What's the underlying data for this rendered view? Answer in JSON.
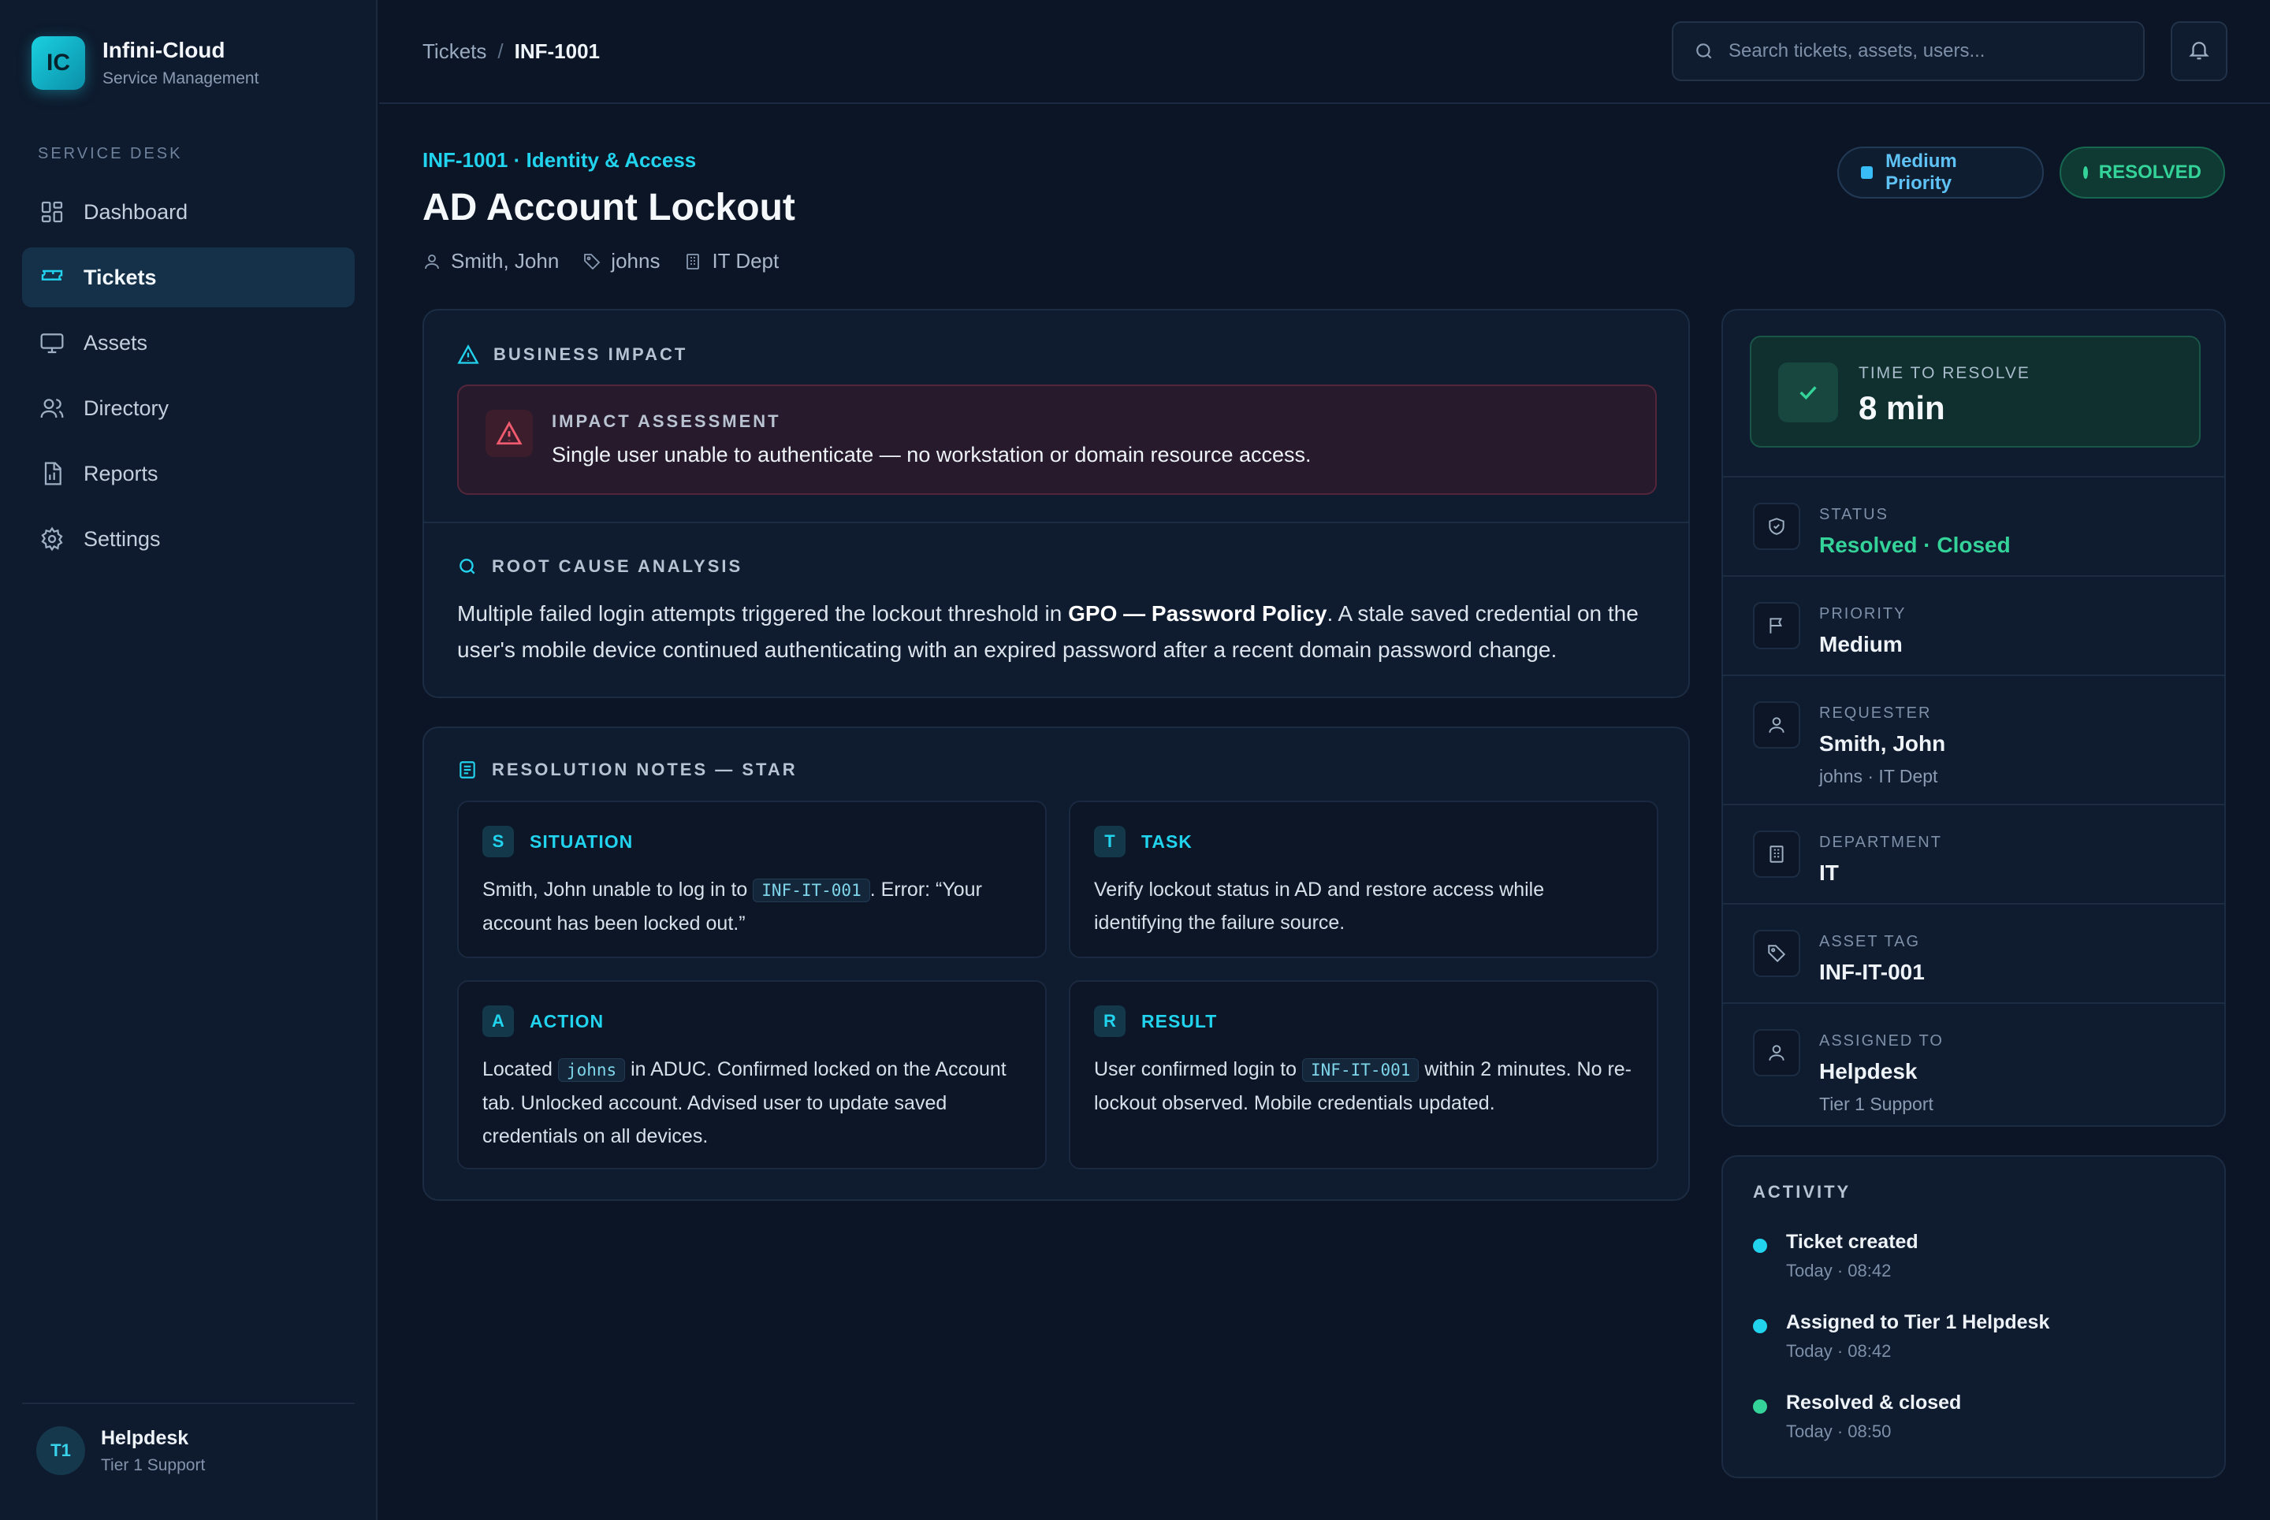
{
  "brand": {
    "logo": "IC",
    "name": "Infini-Cloud",
    "subtitle": "Service Management"
  },
  "sidebar": {
    "section_label": "SERVICE DESK",
    "items": [
      {
        "label": "Dashboard",
        "icon": "dashboard-icon",
        "active": false
      },
      {
        "label": "Tickets",
        "icon": "ticket-icon",
        "active": true
      },
      {
        "label": "Assets",
        "icon": "monitor-icon",
        "active": false
      },
      {
        "label": "Directory",
        "icon": "users-icon",
        "active": false
      },
      {
        "label": "Reports",
        "icon": "report-icon",
        "active": false
      },
      {
        "label": "Settings",
        "icon": "gear-icon",
        "active": false
      }
    ],
    "user": {
      "initials": "T1",
      "name": "Helpdesk",
      "role": "Tier 1 Support"
    }
  },
  "topbar": {
    "breadcrumb": {
      "parent": "Tickets",
      "separator": "/",
      "current": "INF-1001"
    },
    "search": {
      "placeholder": "Search tickets, assets, users..."
    }
  },
  "ticket": {
    "kicker": "INF-1001 · Identity & Access",
    "title": "AD Account Lockout",
    "meta": {
      "user": "Smith, John",
      "tag": "johns",
      "dept": "IT Dept"
    },
    "priority_pill": "Medium Priority",
    "status_pill": "RESOLVED"
  },
  "impact": {
    "section_title": "BUSINESS IMPACT",
    "assessment_label": "IMPACT ASSESSMENT",
    "assessment_text": "Single user unable to authenticate — no workstation or domain resource access."
  },
  "rca": {
    "section_title": "ROOT CAUSE ANALYSIS",
    "text_before": "Multiple failed login attempts triggered the lockout threshold in ",
    "text_bold": "GPO — Password Policy",
    "text_after": ". A stale saved credential on the user's mobile device continued authenticating with an expired password after a recent domain password change."
  },
  "star": {
    "section_title": "RESOLUTION NOTES — STAR",
    "situation": {
      "letter": "S",
      "title": "SITUATION",
      "t1": "Smith, John unable to log in to ",
      "code": "INF-IT-001",
      "t2": ". Error: “Your account has been locked out.”"
    },
    "task": {
      "letter": "T",
      "title": "TASK",
      "text": "Verify lockout status in AD and restore access while identifying the failure source."
    },
    "action": {
      "letter": "A",
      "title": "ACTION",
      "t1": "Located ",
      "code": "johns",
      "t2": " in ADUC. Confirmed locked on the Account tab. Unlocked account. Advised user to update saved credentials on all devices."
    },
    "result": {
      "letter": "R",
      "title": "RESULT",
      "t1": "User confirmed login to ",
      "code": "INF-IT-001",
      "t2": " within 2 minutes. No re-lockout observed. Mobile credentials updated."
    }
  },
  "details": {
    "ttr_label": "TIME TO RESOLVE",
    "ttr_value": "8 min",
    "status": {
      "label": "STATUS",
      "value": "Resolved · Closed"
    },
    "priority": {
      "label": "PRIORITY",
      "value": "Medium"
    },
    "requester": {
      "label": "REQUESTER",
      "value": "Smith, John",
      "sub": "johns · IT Dept"
    },
    "department": {
      "label": "DEPARTMENT",
      "value": "IT"
    },
    "asset": {
      "label": "ASSET TAG",
      "value": "INF-IT-001"
    },
    "assigned": {
      "label": "ASSIGNED TO",
      "value": "Helpdesk",
      "sub": "Tier 1 Support"
    }
  },
  "activity": {
    "title": "ACTIVITY",
    "items": [
      {
        "title": "Ticket created",
        "time": "Today · 08:42",
        "color": "#22d3ee"
      },
      {
        "title": "Assigned to Tier 1 Helpdesk",
        "time": "Today · 08:42",
        "color": "#22d3ee"
      },
      {
        "title": "Resolved & closed",
        "time": "Today · 08:50",
        "color": "#34d399"
      }
    ]
  },
  "colors": {
    "accent": "#22d3ee",
    "success": "#34d399",
    "priority": "#38bdf8",
    "danger": "#f05a6e"
  }
}
